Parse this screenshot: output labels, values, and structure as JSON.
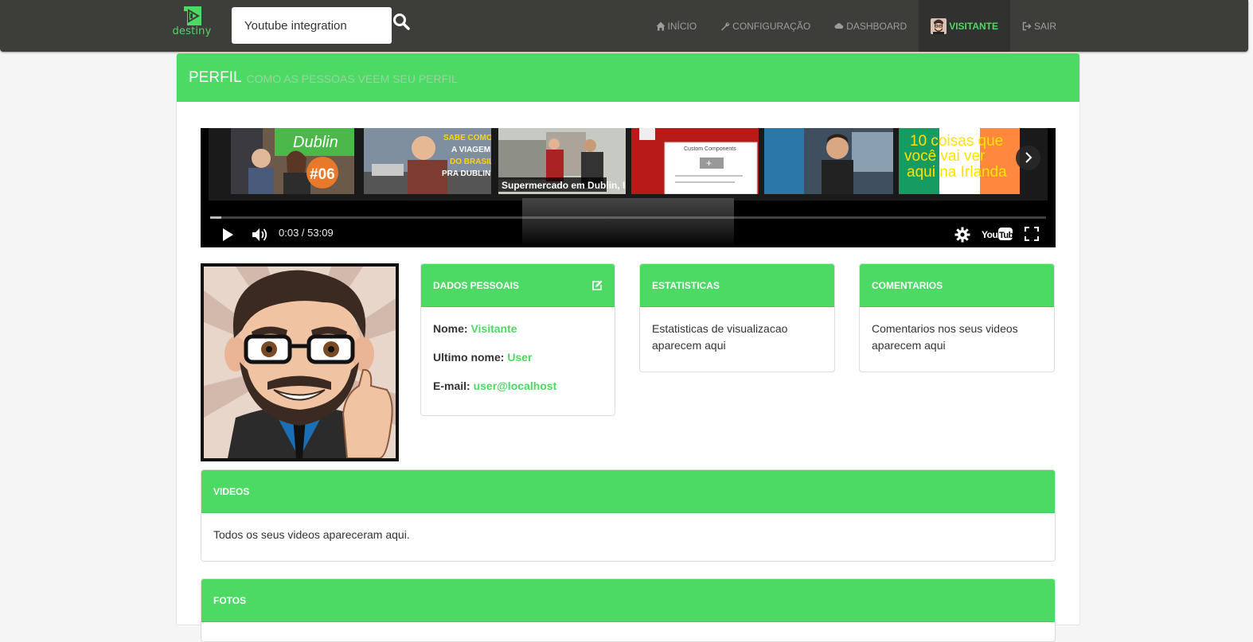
{
  "brand": {
    "name": "destiny"
  },
  "search": {
    "value": "Youtube integration"
  },
  "nav": {
    "items": [
      {
        "label": "INÍCIO",
        "icon": "home-icon"
      },
      {
        "label": "CONFIGURAÇÃO",
        "icon": "wrench-icon"
      },
      {
        "label": "DASHBOARD",
        "icon": "cloud-icon"
      },
      {
        "label": "VISITANTE",
        "icon": "avatar"
      },
      {
        "label": "SAIR",
        "icon": "logout-icon"
      }
    ]
  },
  "header": {
    "title": "PERFIL",
    "subtitle": "COMO AS PESSOAS VEEM SEU PERFIL"
  },
  "video": {
    "time": "0:03 / 53:09",
    "progress": 0.013,
    "thumbs": [
      {
        "caption": "#06",
        "top_text": "Dublin"
      },
      {
        "caption": "SABE COMO É A VIAGEM DO BRASIL PRA DUBLIN?"
      },
      {
        "caption": "Supermercado em Dublin, Irlanda"
      },
      {
        "caption": "Custom Components"
      },
      {
        "caption": ""
      },
      {
        "caption": "10 coisas que você vai ver aqui na Irlanda"
      }
    ]
  },
  "personal": {
    "heading": "DADOS PESSOAIS",
    "name_label": "Nome:",
    "name_value": "Visitante",
    "lastname_label": "Ultimo nome:",
    "lastname_value": "User",
    "email_label": "E-mail:",
    "email_value": "user@localhost"
  },
  "stats": {
    "heading": "ESTATISTICAS",
    "body": "Estatisticas de visualizacao aparecem aqui"
  },
  "comments": {
    "heading": "COMENTARIOS",
    "body": "Comentarios nos seus videos aparecem aqui"
  },
  "videos": {
    "heading": "VIDEOS",
    "body": "Todos os seus videos apareceram aqui."
  },
  "photos": {
    "heading": "FOTOS"
  },
  "colors": {
    "accent": "#4cd964",
    "navbar": "#3d3d3a"
  }
}
